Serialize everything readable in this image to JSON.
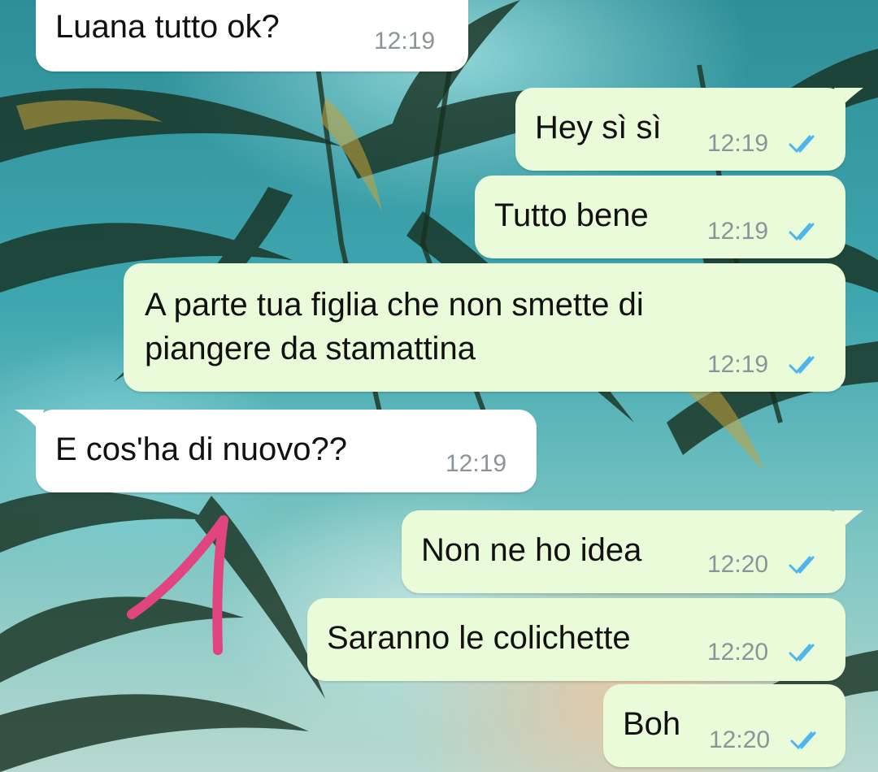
{
  "theme": {
    "incoming_bubble": "#ffffff",
    "outgoing_bubble": "#e9fbd9",
    "read_tick_color": "#4fb6ec",
    "annotation_color": "#e0457f"
  },
  "messages": [
    {
      "direction": "incoming",
      "text": "Luana tutto ok?",
      "time": "12:19"
    },
    {
      "direction": "outgoing",
      "text": "Hey sì sì",
      "time": "12:19",
      "status_icon": "double-check-read-icon"
    },
    {
      "direction": "outgoing",
      "text": "Tutto bene",
      "time": "12:19",
      "status_icon": "double-check-read-icon"
    },
    {
      "direction": "outgoing",
      "text": "A parte tua figlia che non smette di\npiangere da stamattina",
      "time": "12:19",
      "status_icon": "double-check-read-icon"
    },
    {
      "direction": "incoming",
      "text": "E cos'ha di nuovo??",
      "time": "12:19"
    },
    {
      "direction": "outgoing",
      "text": "Non ne ho idea",
      "time": "12:20",
      "status_icon": "double-check-read-icon"
    },
    {
      "direction": "outgoing",
      "text": "Saranno le colichette",
      "time": "12:20",
      "status_icon": "double-check-read-icon"
    },
    {
      "direction": "outgoing",
      "text": "Boh",
      "time": "12:20",
      "status_icon": "double-check-read-icon"
    }
  ],
  "annotation": {
    "shape": "handwritten-number-one"
  }
}
